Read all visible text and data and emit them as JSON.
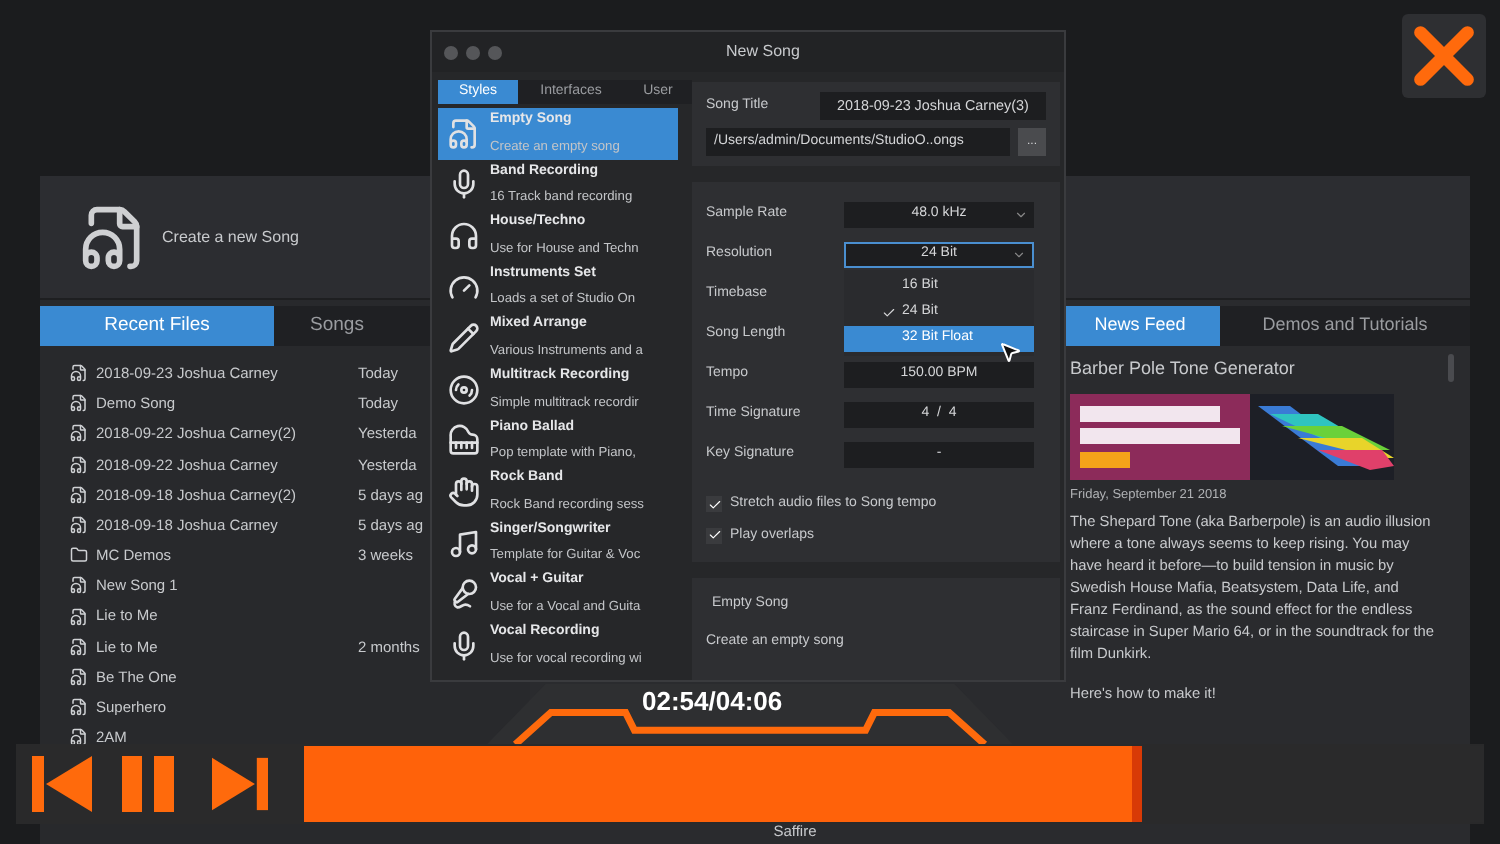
{
  "app": {
    "create_label": "Create a new Song",
    "file_tabs": [
      {
        "label": "Recent Files",
        "selected": true
      },
      {
        "label": "Songs",
        "selected": false
      }
    ],
    "files": [
      {
        "name": "2018-09-23 Joshua Carney",
        "date": "Today",
        "kind": "song"
      },
      {
        "name": "Demo Song",
        "date": "Today",
        "kind": "song"
      },
      {
        "name": "2018-09-22 Joshua Carney(2)",
        "date": "Yesterda",
        "kind": "song"
      },
      {
        "name": "2018-09-22 Joshua Carney",
        "date": "Yesterda",
        "kind": "song"
      },
      {
        "name": "2018-09-18 Joshua Carney(2)",
        "date": "5 days ag",
        "kind": "song"
      },
      {
        "name": "2018-09-18 Joshua Carney",
        "date": "5 days ag",
        "kind": "song"
      },
      {
        "name": "MC Demos",
        "date": "3 weeks",
        "kind": "folder"
      },
      {
        "name": "New Song 1",
        "kind": "song"
      },
      {
        "name": "Lie to Me",
        "kind": "song"
      },
      {
        "name": "Lie to Me",
        "date": "2 months",
        "kind": "song"
      },
      {
        "name": "Be The One",
        "kind": "song"
      },
      {
        "name": "Superhero",
        "kind": "song"
      },
      {
        "name": "2AM",
        "kind": "song"
      }
    ],
    "bottom_text": "Saffire",
    "news_tabs": [
      {
        "label": "News Feed",
        "selected": true
      },
      {
        "label": "Demos and Tutorials",
        "selected": false
      }
    ],
    "news": {
      "title": "Barber Pole Tone Generator",
      "date": "Friday, September 21 2018",
      "body": "The Shepard Tone (aka Barberpole) is an audio illusion where a tone always seems to keep rising. You may have heard it before—to build tension in music by Swedish House Mafia, Beatsystem, Data Life, and Franz Ferdinand, as the sound effect for the endless staircase in Super Mario 64, or in the soundtrack for the film Dunkirk.",
      "link": "Here's how to make it!"
    }
  },
  "dialog": {
    "title": "New Song",
    "style_tabs": [
      {
        "label": "Styles",
        "selected": true
      },
      {
        "label": "Interfaces",
        "selected": false
      },
      {
        "label": "User",
        "selected": false
      }
    ],
    "styles": [
      {
        "title": "Empty Song",
        "description": "Create an empty song",
        "kind": "document",
        "selected": true
      },
      {
        "title": "Band Recording",
        "description": "16 Track band recording",
        "kind": "mic",
        "selected": false
      },
      {
        "title": "House/Techno",
        "description": "Use for House and Techn",
        "kind": "headphones",
        "selected": false
      },
      {
        "title": "Instruments Set",
        "description": "Loads a set of  Studio On",
        "kind": "knob",
        "selected": false
      },
      {
        "title": "Mixed Arrange",
        "description": "Various Instruments and a",
        "kind": "pencil",
        "selected": false
      },
      {
        "title": "Multitrack Recording",
        "description": "Simple multitrack recordir",
        "kind": "disc",
        "selected": false
      },
      {
        "title": "Piano Ballad",
        "description": "Pop template with Piano,",
        "kind": "piano",
        "selected": false
      },
      {
        "title": "Rock Band",
        "description": "Rock Band recording sess",
        "kind": "hand",
        "selected": false
      },
      {
        "title": "Singer/Songwriter",
        "description": "Template for Guitar & Voc",
        "kind": "note",
        "selected": false
      },
      {
        "title": "Vocal + Guitar",
        "description": "Use for a Vocal and Guita",
        "kind": "vocal",
        "selected": false
      },
      {
        "title": "Vocal Recording",
        "description": "Use for vocal recording wi",
        "kind": "mic",
        "selected": false
      }
    ],
    "song_title_label": "Song Title",
    "song_title": "2018-09-23 Joshua Carney(3)",
    "path": "/Users/admin/Documents/StudioO..ongs",
    "browse_label": "...",
    "settings": [
      {
        "label": "Sample Rate",
        "value": "48.0 kHz",
        "kind": "dropdown"
      },
      {
        "label": "Resolution",
        "value": "24 Bit",
        "kind": "dropdown",
        "open": true
      },
      {
        "label": "Timebase",
        "kind": "hidden"
      },
      {
        "label": "Song Length",
        "kind": "hidden"
      },
      {
        "label": "Tempo",
        "value": "150.00 BPM",
        "kind": "field"
      },
      {
        "label": "Time Signature",
        "value": "4  /  4",
        "kind": "field"
      },
      {
        "label": "Key Signature",
        "value": "-",
        "kind": "field"
      }
    ],
    "dropdown_options": [
      {
        "label": "16 Bit",
        "checked": false,
        "selected": false
      },
      {
        "label": "24 Bit",
        "checked": true,
        "selected": false
      },
      {
        "label": "32 Bit Float",
        "checked": false,
        "selected": true
      }
    ],
    "checkboxes": [
      {
        "label": "Stretch audio files to Song tempo",
        "checked": true
      },
      {
        "label": "Play overlaps",
        "checked": true
      }
    ],
    "summary": {
      "title": "Empty Song",
      "description": "Create an empty song"
    }
  },
  "player": {
    "time": "02:54/04:06",
    "level": 0.71
  }
}
